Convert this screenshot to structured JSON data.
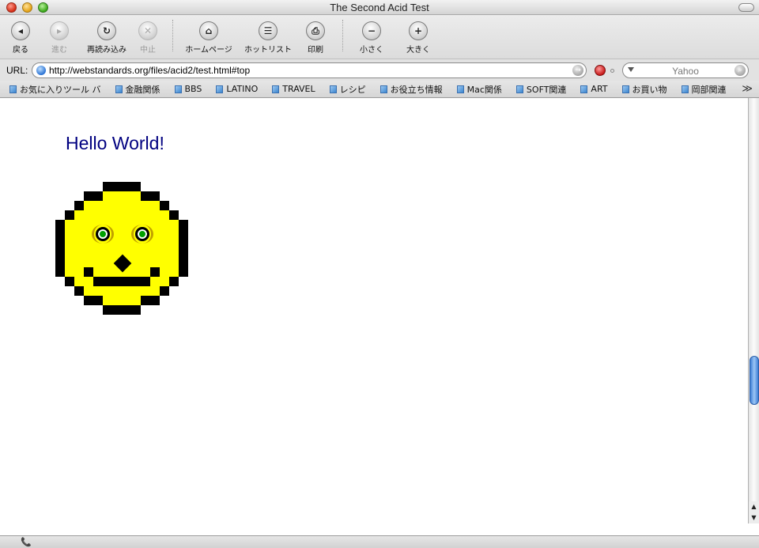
{
  "window": {
    "title": "The Second Acid Test"
  },
  "toolbar": {
    "buttons": [
      {
        "label": "戻る",
        "glyph": "◂"
      },
      {
        "label": "進む",
        "glyph": "▸"
      },
      {
        "label": "再読み込み",
        "glyph": "↻"
      },
      {
        "label": "中止",
        "glyph": "✕"
      },
      {
        "label": "ホームページ",
        "glyph": "⌂"
      },
      {
        "label": "ホットリスト",
        "glyph": "☰"
      },
      {
        "label": "印刷",
        "glyph": "⎙"
      },
      {
        "label": "小さく",
        "glyph": "−"
      },
      {
        "label": "大きく",
        "glyph": "+"
      }
    ]
  },
  "address": {
    "label": "URL:",
    "url": "http://webstandards.org/files/acid2/test.html#top",
    "go_glyph": "→",
    "search_placeholder": "Yahoo",
    "search_glyph": "⌕"
  },
  "bookmarks": {
    "items": [
      "お気に入りツール バ",
      "金融関係",
      "BBS",
      "LATINO",
      "TRAVEL",
      "レシピ",
      "お役立ち情報",
      "Mac関係",
      "SOFT関連",
      "ART",
      "お買い物",
      "岡部関連"
    ],
    "more_glyph": "≫"
  },
  "content": {
    "heading": "Hello World!",
    "face_colors": {
      "fill": "#ffff00",
      "outline": "#000000",
      "iris": "#00a000",
      "brow": "#c0a000"
    }
  },
  "scrollbar": {
    "up_glyph": "▲",
    "down_glyph": "▼"
  },
  "status": {
    "phone_glyph": "📞"
  }
}
